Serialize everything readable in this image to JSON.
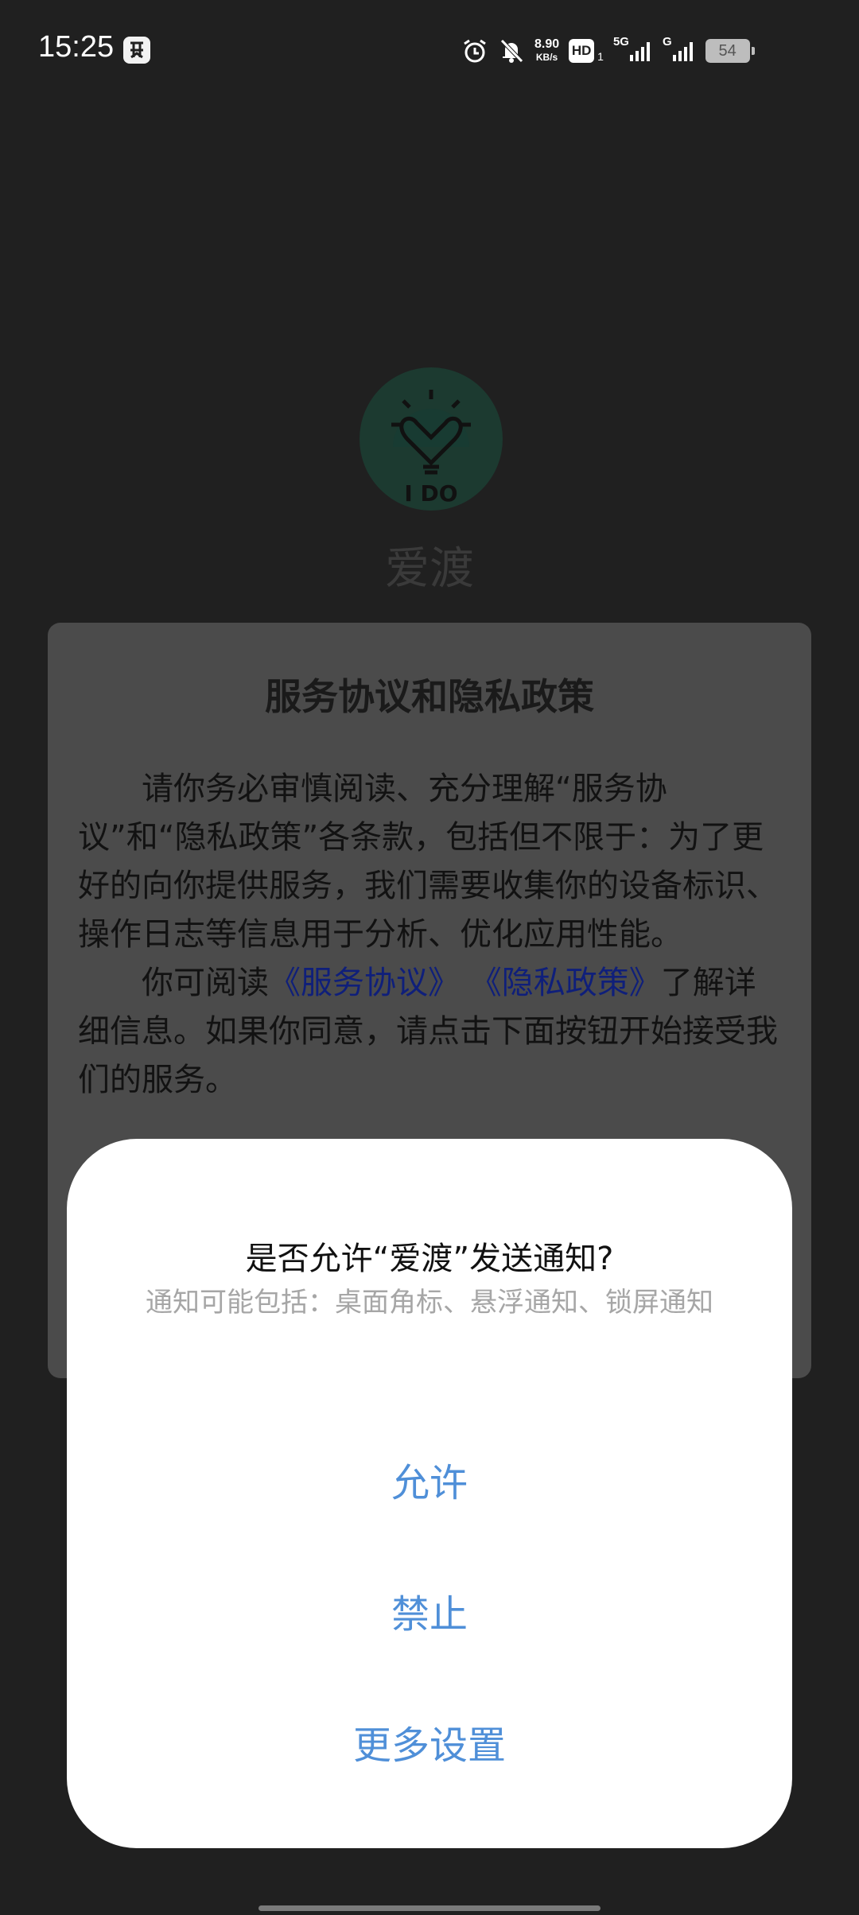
{
  "status_bar": {
    "time": "15:25",
    "network_speed": "8.90",
    "network_speed_unit": "KB/s",
    "hd_label": "HD",
    "hd_sub": "1",
    "sim1_label": "5G",
    "sim2_label": "G",
    "battery": "54",
    "icons": [
      "app-notification-icon",
      "alarm-icon",
      "mute-icon",
      "signal-icon",
      "battery-icon"
    ]
  },
  "app": {
    "logo_text": "I DO",
    "name": "爱渡"
  },
  "privacy_dialog": {
    "title": "服务协议和隐私政策",
    "para1": "请你务必审慎阅读、充分理解“服务协议”和“隐私政策”各条款，包括但不限于：为了更好的向你提供服务，我们需要收集你的设备标识、操作日志等信息用于分析、优化应用性能。",
    "para2_prefix": "你可阅读",
    "service_link": "《服务协议》",
    "privacy_link": "《隐私政策》",
    "para2_suffix": "了解详细信息。如果你同意，请点击下面按钮开始接受我们的服务。"
  },
  "notification_sheet": {
    "title": "是否允许“爱渡”发送通知?",
    "subtitle": "通知可能包括：桌面角标、悬浮通知、锁屏通知",
    "allow_label": "允许",
    "deny_label": "禁止",
    "more_label": "更多设置"
  }
}
